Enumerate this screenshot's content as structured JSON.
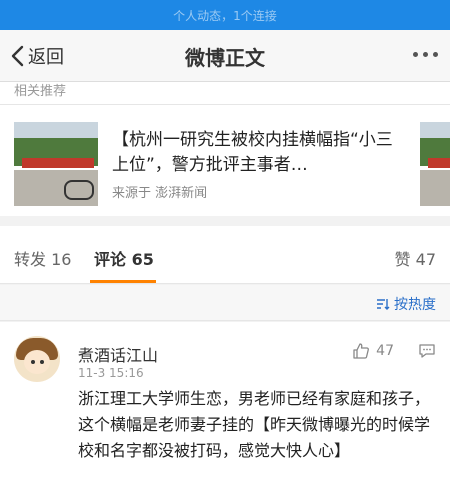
{
  "status_bar": {
    "text": "个人动态，1个连接"
  },
  "navbar": {
    "back_label": "返回",
    "title": "微博正文"
  },
  "related": {
    "heading": "相关推荐",
    "title": "【杭州一研究生被校内挂横幅指“小三上位”，警方批评主事者…",
    "source": "来源于 澎湃新闻"
  },
  "tabs": {
    "repost": "转发 16",
    "comment": "评论 65",
    "like": "赞 47"
  },
  "sort": {
    "label": "按热度"
  },
  "comment": {
    "username": "煮酒话江山",
    "time": "11-3 15:16",
    "like_count": "47",
    "text": "浙江理工大学师生恋，男老师已经有家庭和孩子，这个横幅是老师妻子挂的【昨天微博曝光的时候学校和名字都没被打码，感觉大快人心】"
  },
  "colors": {
    "accent": "#ff8200",
    "link": "#2a6fc9",
    "status_bar": "#1e88e5"
  },
  "icons": {
    "back": "chevron-left-icon",
    "more": "more-dots-icon",
    "sort": "sort-icon",
    "like": "thumbs-up-icon",
    "reply": "comment-bubble-icon"
  }
}
